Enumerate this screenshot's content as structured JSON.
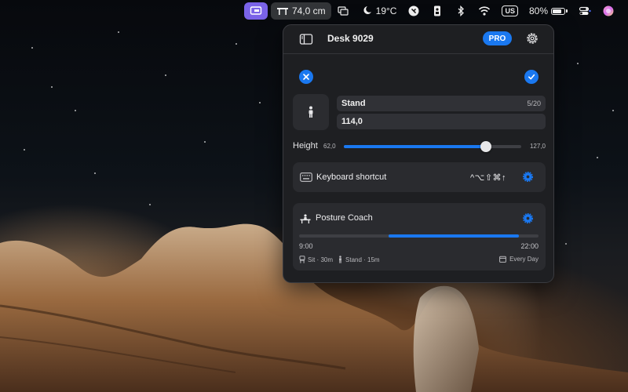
{
  "menubar": {
    "desk_height": "74,0 cm",
    "weather": "19°C",
    "keyboard_layout": "US",
    "battery_percent": "80%",
    "battery_level": 0.8,
    "icons": [
      "desk-app-icon",
      "desk-height-icon",
      "display-mirror-icon",
      "moon-cloud-icon",
      "app-badge-icon",
      "id-card-icon",
      "bluetooth-icon",
      "wifi-icon",
      "battery-charging-icon",
      "control-center-icon",
      "siri-icon"
    ]
  },
  "panel": {
    "device_name": "Desk 9029",
    "pro_label": "PRO",
    "preset": {
      "name": "Stand",
      "name_counter": "5/20",
      "height_value": "114,0"
    },
    "height_slider": {
      "label": "Height",
      "min_label": "62,0",
      "max_label": "127,0",
      "min": 62.0,
      "max": 127.0,
      "value": 114.0
    },
    "shortcut": {
      "label": "Keyboard shortcut",
      "keys": "^⌥⇧⌘↑"
    },
    "posture_coach": {
      "label": "Posture Coach",
      "start_time": "9:00",
      "end_time": "22:00",
      "schedule_start_fraction": 0.375,
      "schedule_end_fraction": 0.917,
      "sit_label": "Sit · 30m",
      "stand_label": "Stand · 15m",
      "days_label": "Every Day"
    }
  },
  "colors": {
    "accent": "#1a78f0",
    "active_menu": "#7a63e8",
    "panel_bg": "#1e1f22",
    "card_bg": "#2a2b2f"
  }
}
